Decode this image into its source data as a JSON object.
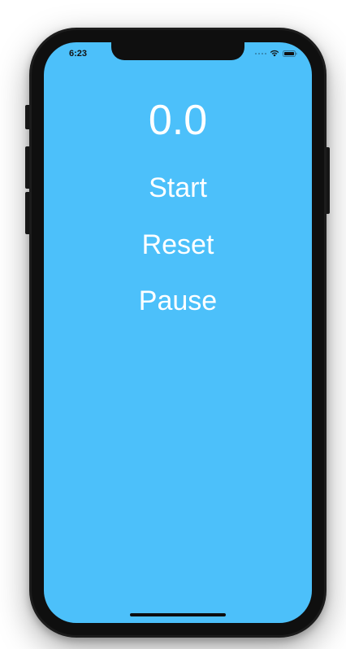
{
  "status_bar": {
    "time": "6:23",
    "icons": [
      "signal-dots-icon",
      "wifi-icon",
      "battery-icon"
    ]
  },
  "app": {
    "background_color": "#4cc0fa",
    "timer_value": "0.0",
    "buttons": {
      "start_label": "Start",
      "reset_label": "Reset",
      "pause_label": "Pause"
    }
  }
}
